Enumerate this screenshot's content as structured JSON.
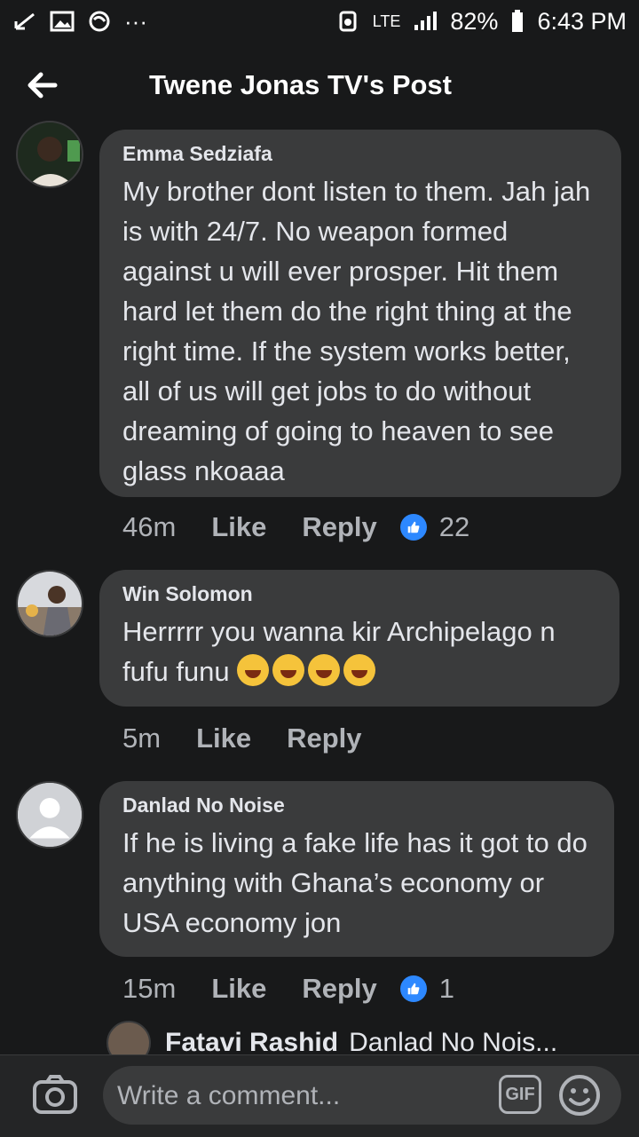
{
  "status": {
    "network": "LTE",
    "battery": "82%",
    "time": "6:43 PM"
  },
  "header": {
    "title": "Twene Jonas TV's Post"
  },
  "comments": [
    {
      "author": "Emma Sedziafa",
      "text": "My brother dont listen to them. Jah jah is with 24/7. No weapon formed against u will ever prosper. Hit them hard let them do the right thing at the right time. If the system works better, all of us will get jobs to do without dreaming of going to heaven to see glass nkoaaa",
      "time": "46m",
      "like": "Like",
      "reply": "Reply",
      "likes": "22"
    },
    {
      "author": "Win Solomon",
      "text": "Herrrrr you wanna kir Archipelago n fufu funu",
      "time": "5m",
      "like": "Like",
      "reply": "Reply"
    },
    {
      "author": "Danlad No Noise",
      "text": "If he is living a fake life has it got to do anything with Ghana’s economy or USA economy jon",
      "time": "15m",
      "like": "Like",
      "reply": "Reply",
      "likes": "1"
    }
  ],
  "reply_preview": {
    "author": "Fatavi Rashid",
    "text": "Danlad No Nois..."
  },
  "composer": {
    "placeholder": "Write a comment...",
    "gif": "GIF"
  },
  "colors": {
    "background": "#18191a",
    "bubble": "#3a3b3c",
    "like_badge": "#2d88ff"
  }
}
